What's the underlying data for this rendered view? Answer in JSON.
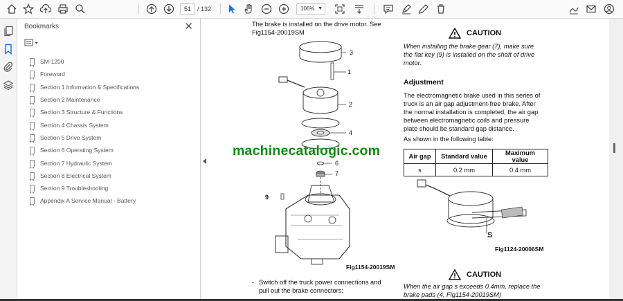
{
  "toolbar": {
    "page_current": "51",
    "page_total": "/ 132",
    "zoom": "106%",
    "icons": [
      "home-icon",
      "star-icon",
      "upload-icon",
      "print-icon",
      "search-icon",
      "page-up-icon",
      "page-down-icon",
      "cursor-icon",
      "hand-icon",
      "zoom-out-icon",
      "zoom-in-icon",
      "fit-icon",
      "scroll-mode-icon",
      "comment-icon",
      "highlight-icon",
      "draw-icon",
      "delete-icon",
      "sign-icon",
      "mail-icon",
      "account-icon"
    ]
  },
  "sidebar": {
    "title": "Bookmarks",
    "items": [
      "SM-1200",
      "Foreword",
      "Section 1 Information & Specifications",
      "Section 2 Maintenance",
      "Section 3 Structure & Functions",
      "Section 4 Chassis System",
      "Section 5 Drive System",
      "Section 6 Operating System",
      "Section 7 Hydraulic System",
      "Section 8 Electrical System",
      "Section 9 Troubleshooting",
      "Appendix A Service Manual - Battery"
    ]
  },
  "document": {
    "left_intro_line1": "The brake is installed on the drive motor. See",
    "left_intro_line2": "Fig1154-20019SM",
    "callouts": [
      "3",
      "1",
      "2",
      "4",
      "6",
      "7",
      "9"
    ],
    "fig_left_caption": "Fig1154-20019SM",
    "bullet_line1": "Switch off the truck power connections and",
    "bullet_line2": "pull out the brake connectors;",
    "caution1_title": "CAUTION",
    "caution1_line1": "When installing the brake gear (7), make sure",
    "caution1_line2": "the flat key (9) is installed on the shaft of drive",
    "caution1_line3": "motor.",
    "adjust_heading": "Adjustment",
    "adjust_line1": "The electromagnetic brake used in this series of",
    "adjust_line2": "truck is an air gap adjustment-free brake. After",
    "adjust_line3": "the normal installation is completed, the air gap",
    "adjust_line4": "between electromagnetic coils and pressure",
    "adjust_line5": "plate should be standard gap distance.",
    "adjust_line6": "As shown in the following table:",
    "table": {
      "headers": [
        "Air gap",
        "Standard value",
        "Maximum value"
      ],
      "row": [
        "s",
        "0.2 mm",
        "0.4 mm"
      ]
    },
    "fig_right_label": "S",
    "fig_right_caption": "Fig1124-20006SM",
    "caution2_title": "CAUTION",
    "caution2_line1": "When the air gap s exceeds 0.4mm, replace the",
    "caution2_line2": "brake pads (4, Fig1154-20019SM)",
    "watermark": "machinecatalogic.com"
  }
}
